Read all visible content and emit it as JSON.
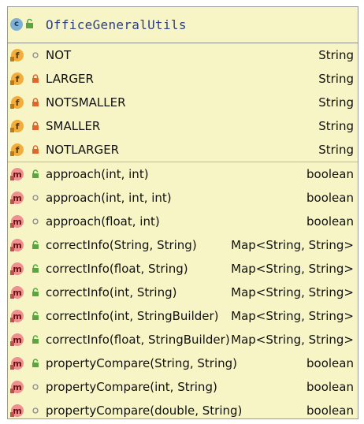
{
  "class_name": "OfficeGeneralUtils",
  "class_icon_letter": "c",
  "fields": [
    {
      "name": "NOT",
      "type": "String",
      "visibility": "package"
    },
    {
      "name": "LARGER",
      "type": "String",
      "visibility": "private"
    },
    {
      "name": "NOTSMALLER",
      "type": "String",
      "visibility": "private"
    },
    {
      "name": "SMALLER",
      "type": "String",
      "visibility": "private"
    },
    {
      "name": "NOTLARGER",
      "type": "String",
      "visibility": "private"
    }
  ],
  "methods": [
    {
      "name": "approach(int, int)",
      "type": "boolean",
      "visibility": "public"
    },
    {
      "name": "approach(int, int, int)",
      "type": "boolean",
      "visibility": "package"
    },
    {
      "name": "approach(float, int)",
      "type": "boolean",
      "visibility": "package"
    },
    {
      "name": "correctInfo(String, String)",
      "type": "Map<String, String>",
      "visibility": "public"
    },
    {
      "name": "correctInfo(float, String)",
      "type": "Map<String, String>",
      "visibility": "public"
    },
    {
      "name": "correctInfo(int, String)",
      "type": "Map<String, String>",
      "visibility": "public"
    },
    {
      "name": "correctInfo(int, StringBuilder)",
      "type": "Map<String, String>",
      "visibility": "public"
    },
    {
      "name": "correctInfo(float, StringBuilder)",
      "type": "Map<String, String>",
      "visibility": "public"
    },
    {
      "name": "propertyCompare(String, String)",
      "type": "boolean",
      "visibility": "public"
    },
    {
      "name": "propertyCompare(int, String)",
      "type": "boolean",
      "visibility": "package"
    },
    {
      "name": "propertyCompare(double, String)",
      "type": "boolean",
      "visibility": "package"
    }
  ],
  "field_icon_letter": "f",
  "method_icon_letter": "m",
  "colors": {
    "background": "#f7f5c6",
    "title": "#2c3f86",
    "class_icon": "#7fb0d4",
    "field_icon": "#f2ad3c",
    "method_icon": "#ef8f8f",
    "public_lock": "#5ba53e",
    "private_lock": "#e0672a"
  }
}
